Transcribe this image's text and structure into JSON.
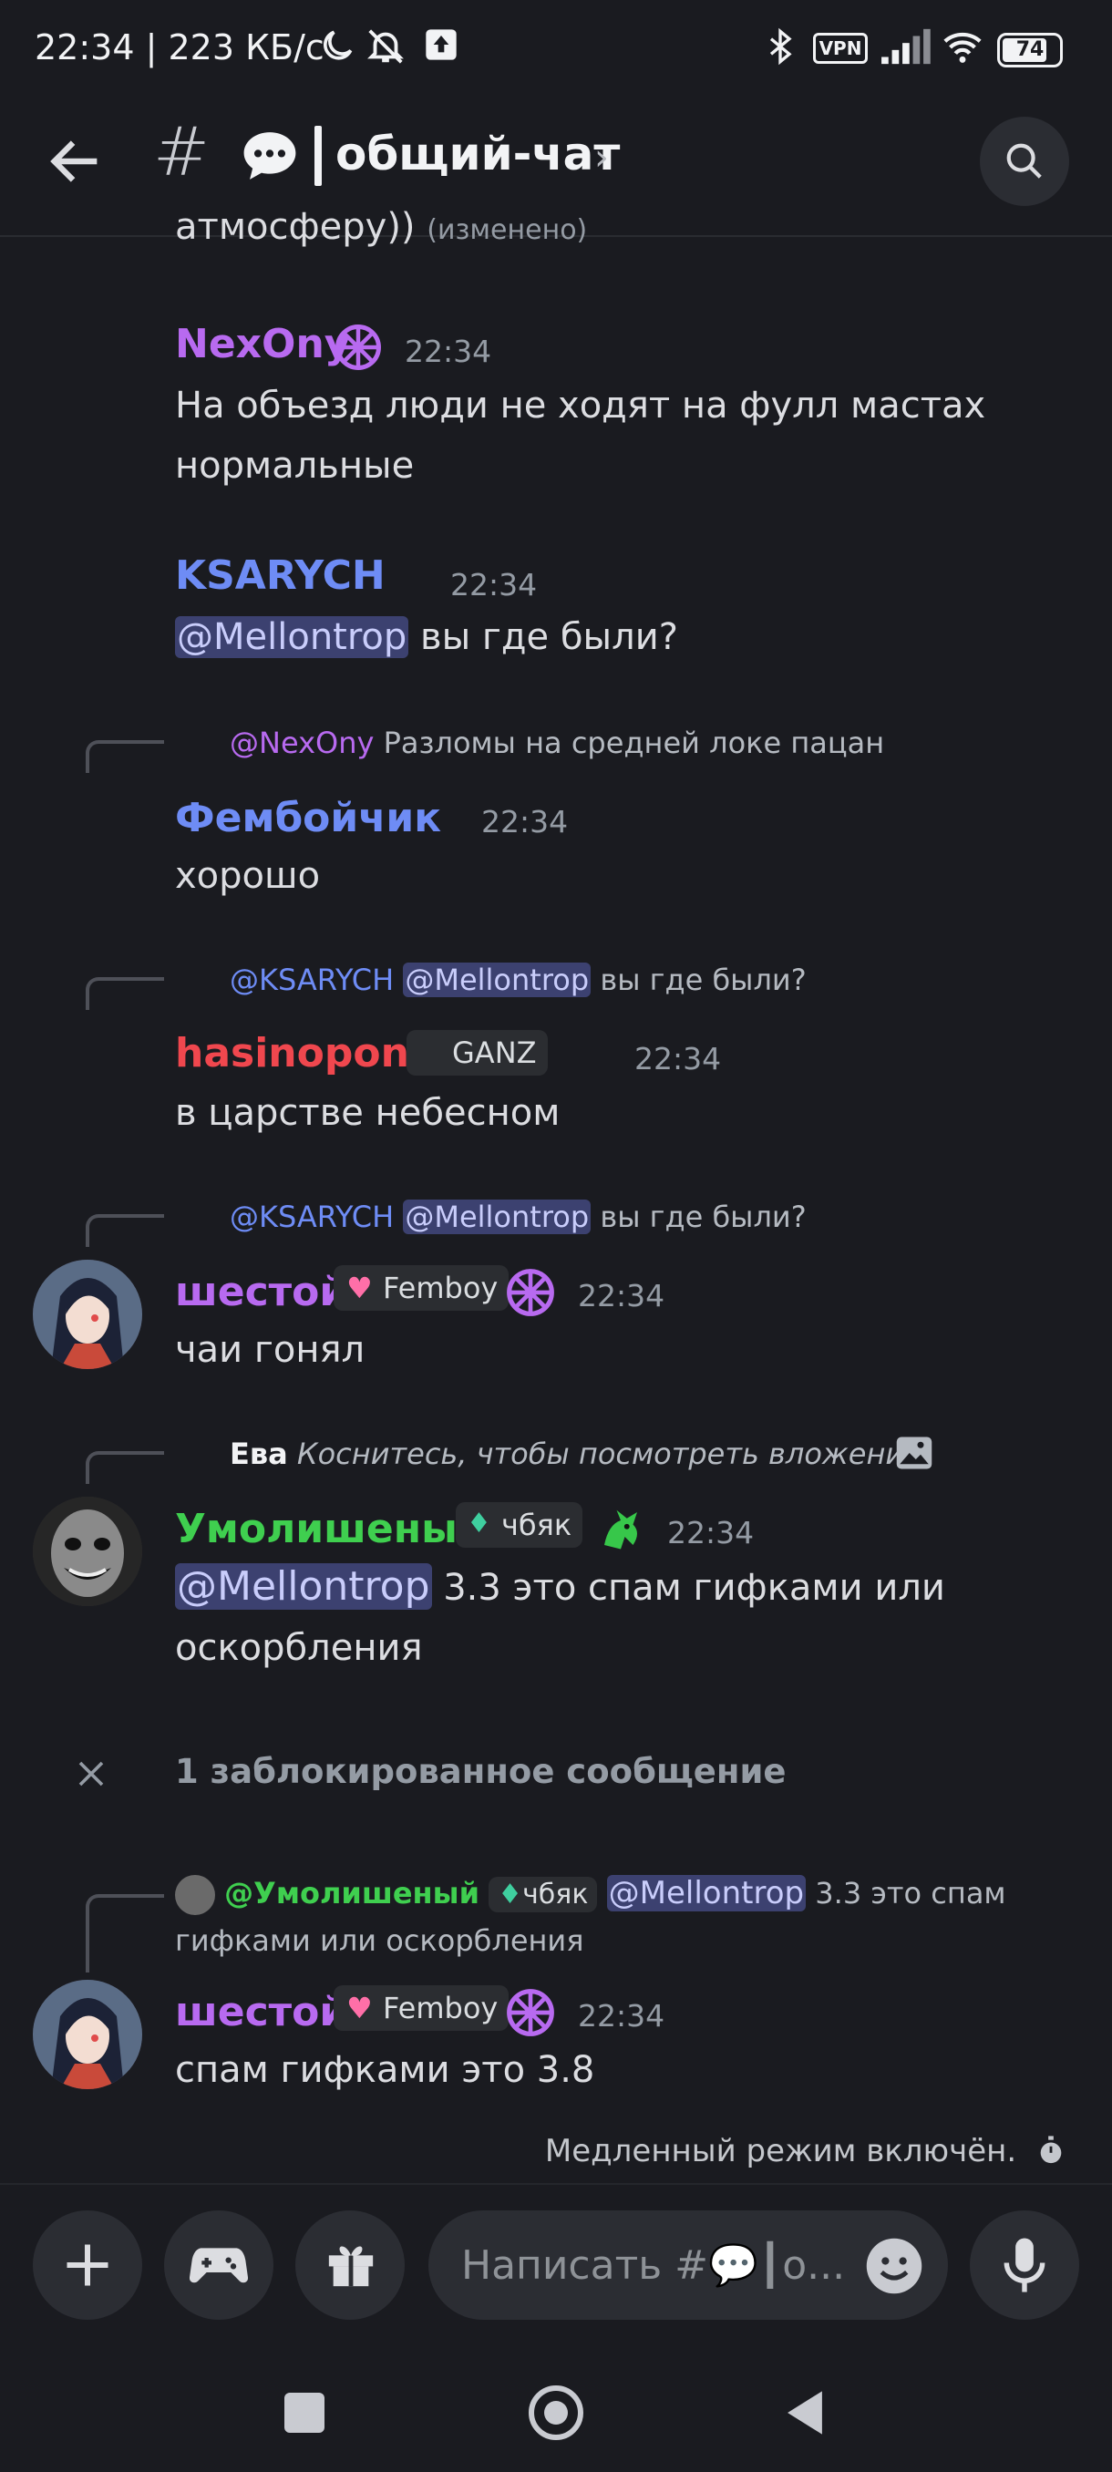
{
  "status_bar": {
    "left_text": "22:34 | 223 КБ/с",
    "vpn_label": "VPN",
    "battery": "74"
  },
  "header": {
    "channel_name": "общий-чат"
  },
  "messages": {
    "partial_text": "атмосферу))",
    "partial_edited": "(изменено)",
    "m1": {
      "author": "NexOny",
      "time": "22:34",
      "line1": "На объезд люди не ходят на фулл мастах",
      "line2": "нормальные"
    },
    "m2": {
      "author": "KSARYCH",
      "time": "22:34",
      "mention": "@Mellontrop",
      "text": " вы где были?"
    },
    "m3": {
      "reply_mention": "@NexOny",
      "reply_text": " Разломы на средней локе пацан",
      "author": "Фембойчик",
      "time": "22:34",
      "text": "хорошо"
    },
    "m4": {
      "reply_author": "@KSARYCH",
      "reply_mention": "@Mellontrop",
      "reply_text": " вы где были?",
      "author": "hasinopona",
      "tag": "GANZ",
      "time": "22:34",
      "text": "в царстве небесном"
    },
    "m5": {
      "reply_author": "@KSARYCH",
      "reply_mention": "@Mellontrop",
      "reply_text": " вы где были?",
      "author": "шестой",
      "tag": "Femboy",
      "time": "22:34",
      "text": "чаи гонял"
    },
    "m6": {
      "reply_author": "Ева",
      "reply_text": "Коснитесь, чтобы посмотреть вложение",
      "author": "Умолишеный",
      "tag": "чбяк",
      "time": "22:34",
      "mention": "@Mellontrop",
      "line1": " 3.3 это спам гифками или",
      "line2": "оскорбления"
    },
    "blocked": {
      "text": "1 заблокированное сообщение"
    },
    "m7": {
      "reply_author": "@Умолишеный",
      "reply_tag": "чбяк",
      "reply_mention": "@Mellontrop",
      "reply_text1": " 3.3 это спам",
      "reply_text2": "гифками или оскорбления",
      "author": "шестой",
      "tag": "Femboy",
      "time": "22:34",
      "text": "спам гифками это 3.8"
    }
  },
  "slowmode": {
    "text": "Медленный режим включён."
  },
  "composer": {
    "placeholder": "Написать #💬┃о..."
  },
  "colors": {
    "background": "#1a1b20",
    "nexony": "#b86af0",
    "ksarych": "#6e8cf5",
    "femboychik": "#6e8cf5",
    "hasinopona": "#f0474e",
    "shestoy": "#b86af0",
    "umolisheny": "#3fcf4f",
    "mention_bg": "#3c4170"
  }
}
